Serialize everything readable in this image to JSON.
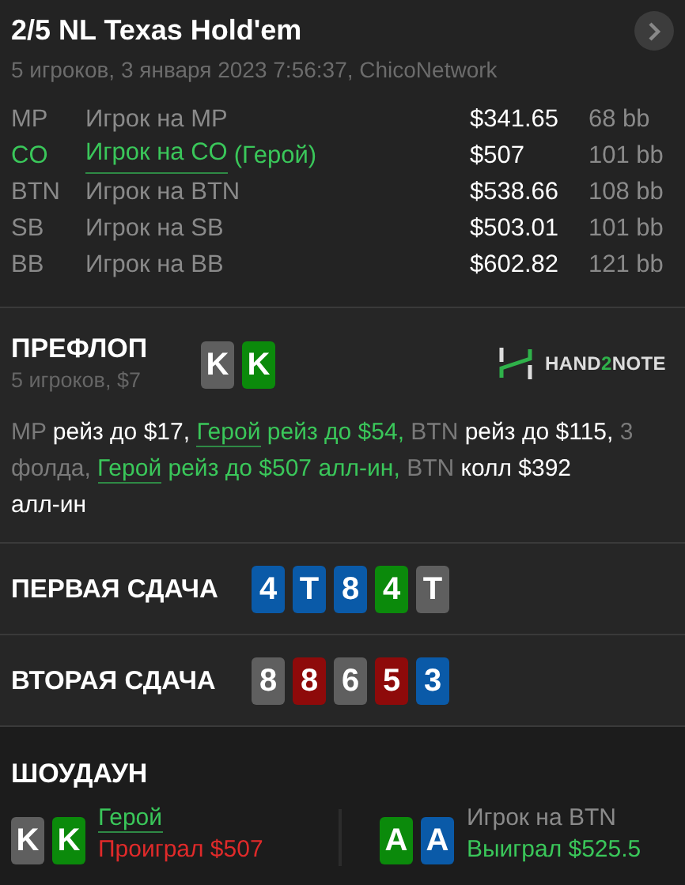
{
  "header": {
    "title": "2/5 NL Texas Hold'em",
    "subtitle": "5 игроков, 3 января 2023 7:56:37, ChicoNetwork"
  },
  "players": [
    {
      "position": "MP",
      "name": "Игрок на MP",
      "stack": "$341.65",
      "bb": "68 bb",
      "hero": false
    },
    {
      "position": "CO",
      "name": "Игрок на CO",
      "hero_label": "(Герой)",
      "stack": "$507",
      "bb": "101 bb",
      "hero": true
    },
    {
      "position": "BTN",
      "name": "Игрок на BTN",
      "stack": "$538.66",
      "bb": "108 bb",
      "hero": false
    },
    {
      "position": "SB",
      "name": "Игрок на SB",
      "stack": "$503.01",
      "bb": "101 bb",
      "hero": false
    },
    {
      "position": "BB",
      "name": "Игрок на BB",
      "stack": "$602.82",
      "bb": "121 bb",
      "hero": false
    }
  ],
  "preflop": {
    "title": "ПРЕФЛОП",
    "subtitle": "5 игроков, $7",
    "cards": [
      {
        "rank": "K",
        "color": "#5f5f5f"
      },
      {
        "rank": "K",
        "color": "#0b8a0b"
      }
    ],
    "logo": [
      "HAND",
      "2",
      "NOTE"
    ],
    "actions": [
      {
        "kind": "actor",
        "text": "MP"
      },
      {
        "kind": "action",
        "text": " рейз до $17, "
      },
      {
        "kind": "hero_link",
        "text": "Герой"
      },
      {
        "kind": "hero",
        "text": " рейз до $54, "
      },
      {
        "kind": "actor",
        "text": "BTN"
      },
      {
        "kind": "action",
        "text": " рейз до $115, "
      },
      {
        "kind": "actor",
        "text": "3 фолда, "
      },
      {
        "kind": "hero_link",
        "text": "Герой"
      },
      {
        "kind": "hero",
        "text": " рейз до $507 алл-ин, "
      },
      {
        "kind": "actor",
        "text": "BTN"
      },
      {
        "kind": "action",
        "text": " колл $392 алл-ин"
      }
    ]
  },
  "boards": [
    {
      "title": "ПЕРВАЯ СДАЧА",
      "cards": [
        {
          "rank": "4",
          "color": "#0a5aa8"
        },
        {
          "rank": "T",
          "color": "#0a5aa8"
        },
        {
          "rank": "8",
          "color": "#0a5aa8"
        },
        {
          "rank": "4",
          "color": "#0b8a0b"
        },
        {
          "rank": "T",
          "color": "#5f5f5f"
        }
      ]
    },
    {
      "title": "ВТОРАЯ СДАЧА",
      "cards": [
        {
          "rank": "8",
          "color": "#5f5f5f"
        },
        {
          "rank": "8",
          "color": "#8e0a0a"
        },
        {
          "rank": "6",
          "color": "#5f5f5f"
        },
        {
          "rank": "5",
          "color": "#8e0a0a"
        },
        {
          "rank": "3",
          "color": "#0a5aa8"
        }
      ]
    }
  ],
  "showdown": {
    "title": "ШОУДАУН",
    "hands": [
      {
        "cards": [
          {
            "rank": "K",
            "color": "#5f5f5f"
          },
          {
            "rank": "K",
            "color": "#0b8a0b"
          }
        ],
        "player": "Герой",
        "hero": true,
        "result": "Проиграл $507",
        "won": false
      },
      {
        "cards": [
          {
            "rank": "A",
            "color": "#0b8a0b"
          },
          {
            "rank": "A",
            "color": "#0a5aa8"
          }
        ],
        "player": "Игрок на BTN",
        "hero": false,
        "result": "Выиграл $525.5",
        "won": true
      }
    ]
  }
}
